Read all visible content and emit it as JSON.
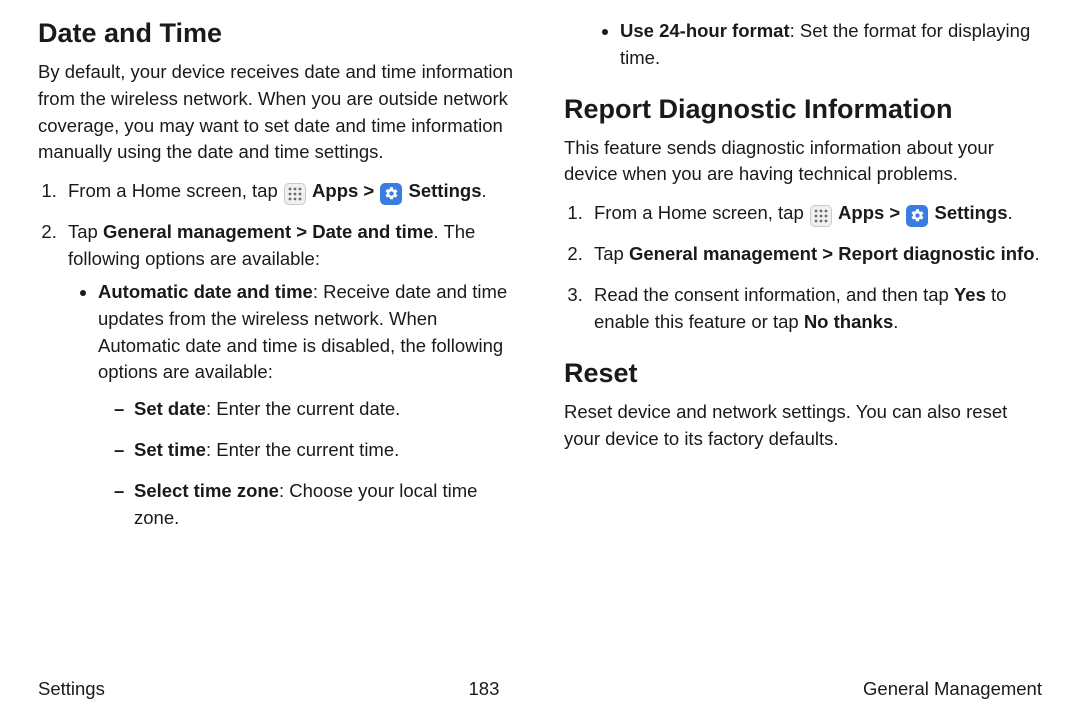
{
  "left": {
    "h_date": "Date and Time",
    "p_date": "By default, your device receives date and time information from the wireless network. When you are outside network coverage, you may want to set date and time information manually using the date and time settings.",
    "step1_a": "From a Home screen, tap ",
    "apps_label": "Apps",
    "chevron": " > ",
    "settings_label": "Settings",
    "step1_end": ".",
    "step2_a": "Tap ",
    "step2_b": "General management > Date and time",
    "step2_c": ". The following options are available:",
    "bul1_b": "Automatic date and time",
    "bul1_r": ": Receive date and time updates from the wireless network. When Automatic date and time is disabled, the following options are available:",
    "d1_b": "Set date",
    "d1_r": ": Enter the current date.",
    "d2_b": "Set time",
    "d2_r": ": Enter the current time.",
    "d3_b": "Select time zone",
    "d3_r": ": Choose your local time zone."
  },
  "right": {
    "bul_top_b": "Use 24-hour format",
    "bul_top_r": ": Set the format for displaying time.",
    "h_report": "Report Diagnostic Information",
    "p_report": "This feature sends diagnostic information about your device when you are having technical problems.",
    "step1_a": "From a Home screen, tap ",
    "apps_label": "Apps",
    "chevron": " > ",
    "settings_label": "Settings",
    "step1_end": ".",
    "step2_a": "Tap ",
    "step2_b": "General management > Report diagnostic info",
    "step2_c": ".",
    "step3_a": "Read the consent information, and then tap ",
    "step3_yes": "Yes",
    "step3_b": " to enable this feature or tap ",
    "step3_no": "No thanks",
    "step3_c": ".",
    "h_reset": "Reset",
    "p_reset": "Reset device and network settings. You can also reset your device to its factory defaults."
  },
  "footer": {
    "left": "Settings",
    "center": "183",
    "right": "General Management"
  }
}
